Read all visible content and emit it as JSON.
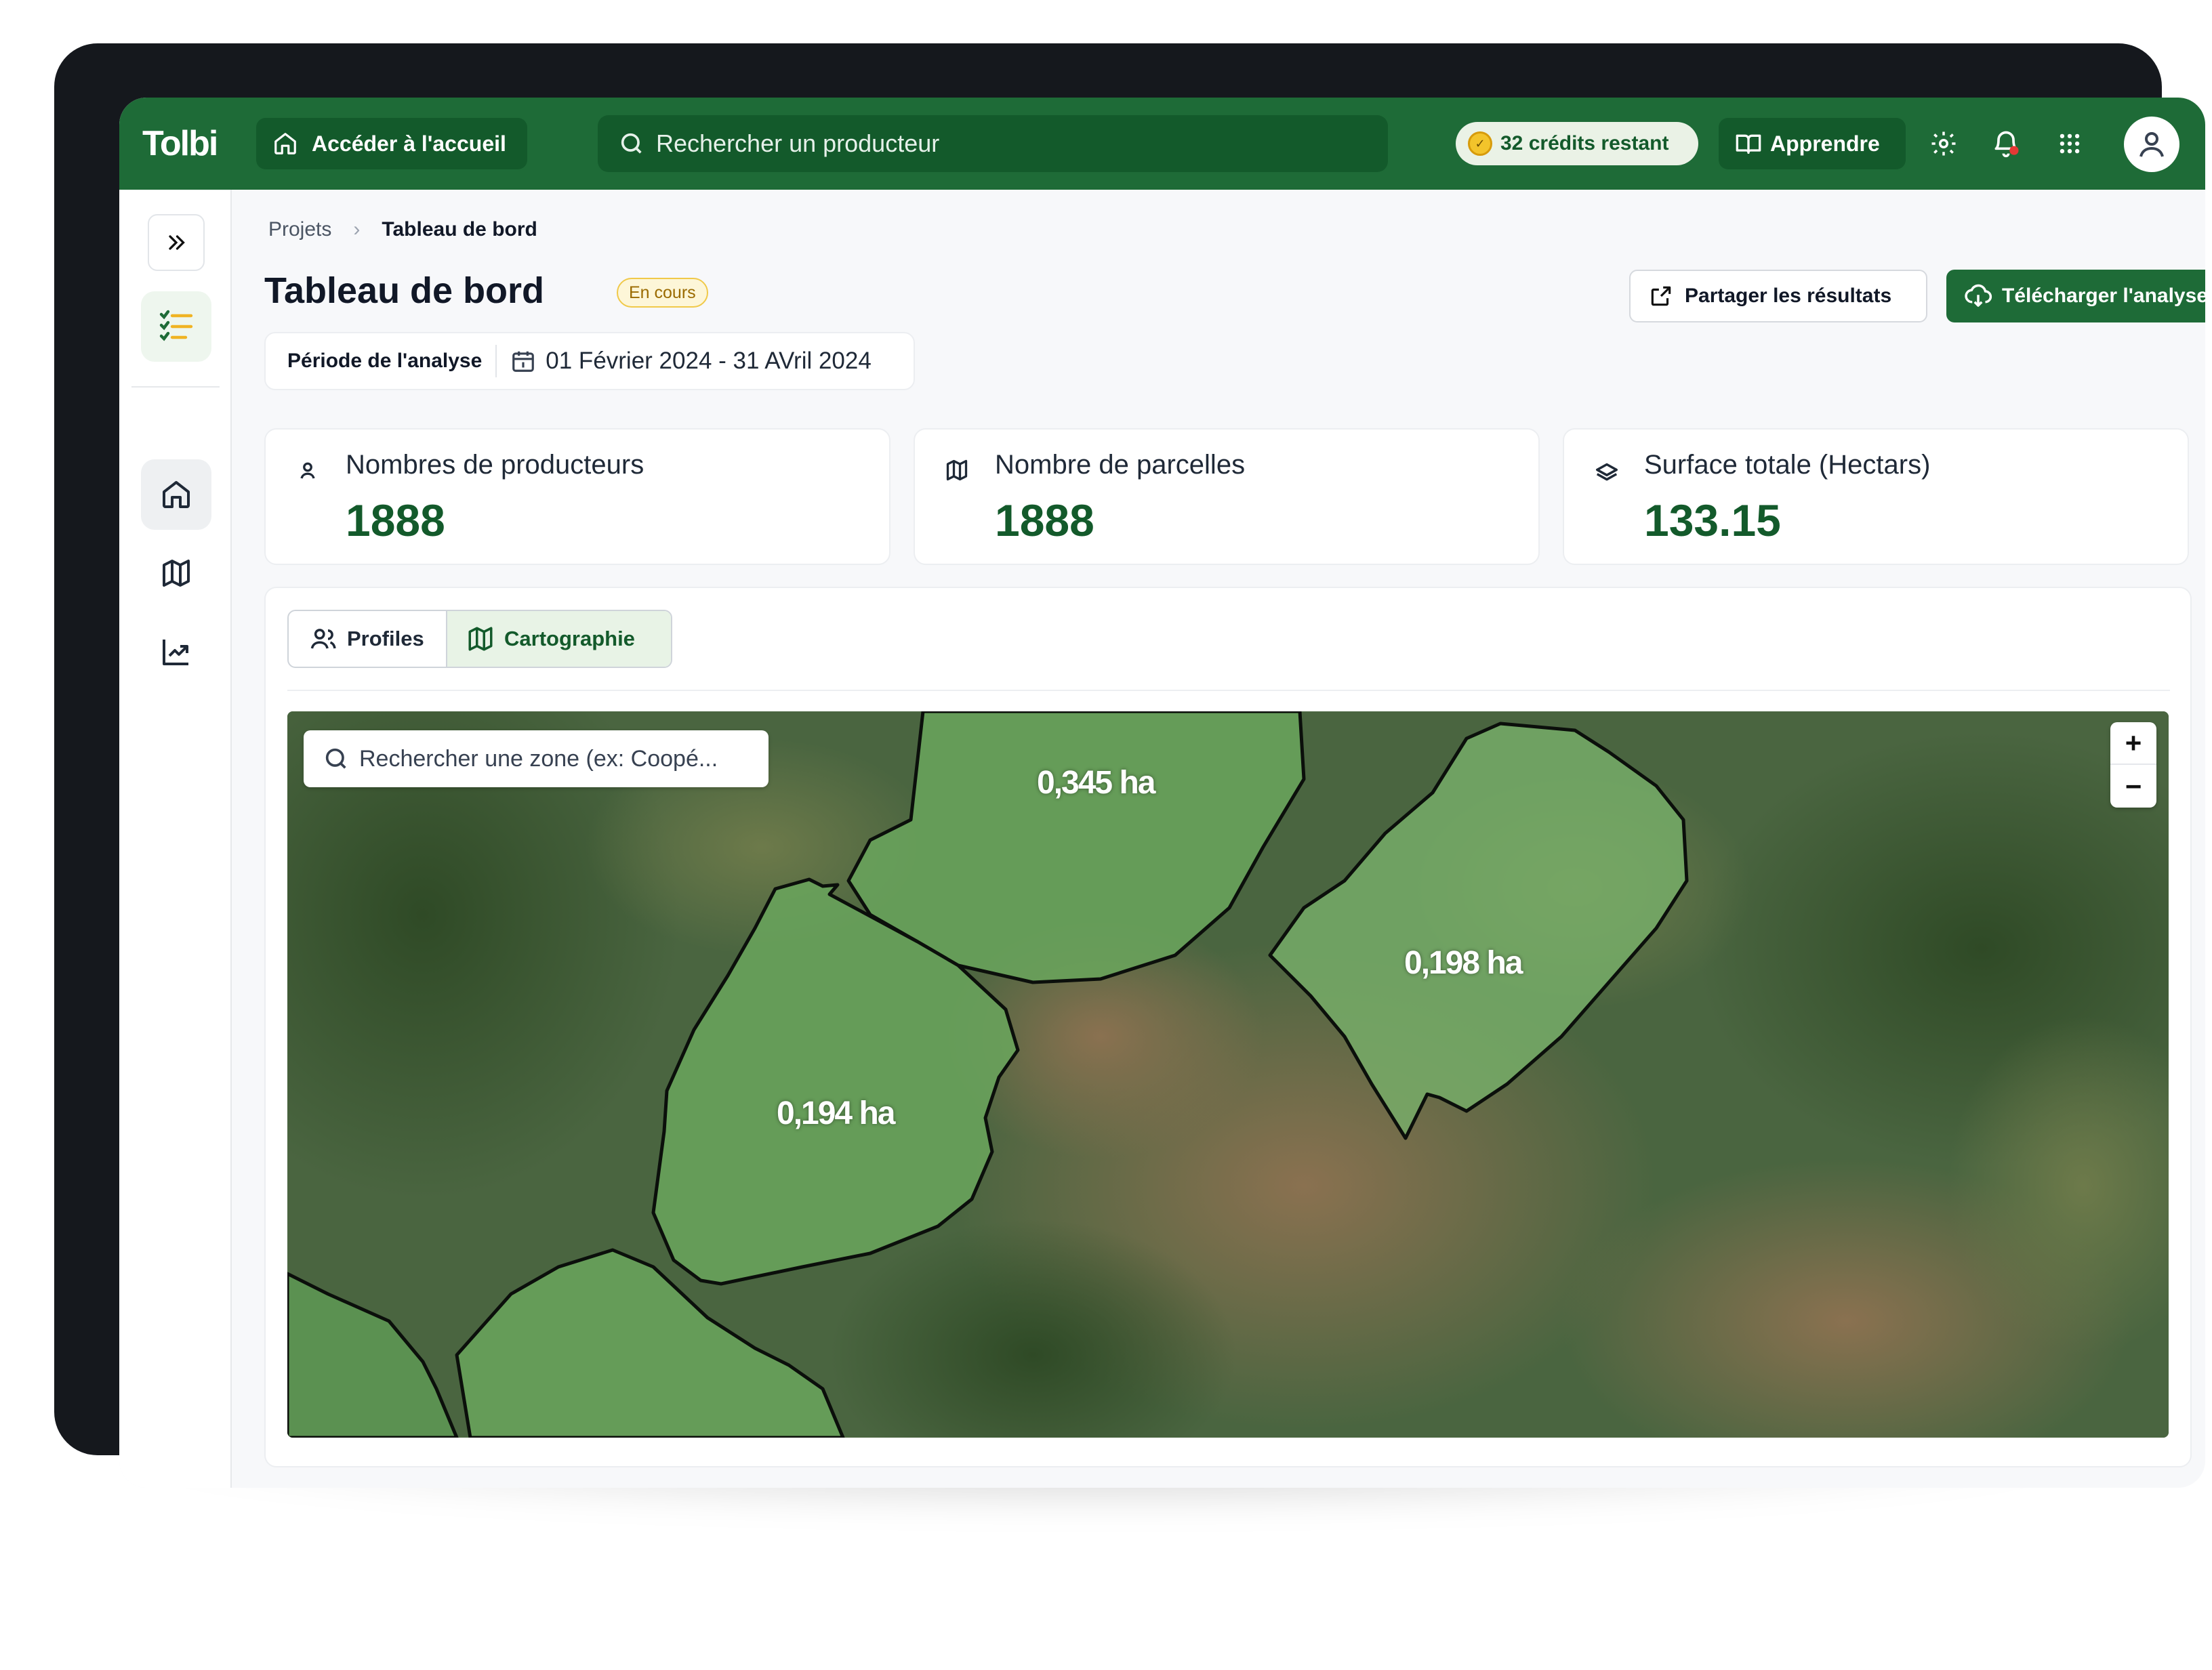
{
  "topbar": {
    "logo": "Tolbi",
    "home_label": "Accéder à l'accueil",
    "search_placeholder": "Rechercher un producteur",
    "credits_label": "32 crédits restant",
    "learn_label": "Apprendre",
    "icons": [
      "home-icon",
      "search-icon",
      "coin-icon",
      "book-icon",
      "gear-icon",
      "bell-icon",
      "grid-icon",
      "user-icon"
    ],
    "notification_dot_color": "#e53935"
  },
  "breadcrumb": {
    "root": "Projets",
    "current": "Tableau de bord"
  },
  "header": {
    "title": "Tableau de bord",
    "status": "En cours",
    "period_label": "Période de l'analyse",
    "period_value": "01 Février 2024 - 31 AVril 2024",
    "share_label": "Partager les résultats",
    "download_label": "Télécharger l'analyse"
  },
  "stats": [
    {
      "title": "Nombres de producteurs",
      "value": "1888",
      "icon": "user-icon"
    },
    {
      "title": "Nombre de parcelles",
      "value": "1888",
      "icon": "map-icon"
    },
    {
      "title": "Surface totale (Hectars)",
      "value": "133.15",
      "icon": "layers-icon"
    }
  ],
  "tabs": {
    "profiles": "Profiles",
    "cartographie": "Cartographie",
    "active": "Cartographie"
  },
  "map": {
    "search_placeholder": "Rechercher une zone (ex: Coopé...",
    "zoom_in": "+",
    "zoom_out": "−",
    "parcels": [
      "0,345 ha",
      "0,198 ha",
      "0,194 ha"
    ]
  },
  "colors": {
    "brand": "#1e6b37",
    "brand_dark": "#135a2b",
    "badge_bg": "#fdf6d8",
    "value_text": "#135a2b"
  }
}
